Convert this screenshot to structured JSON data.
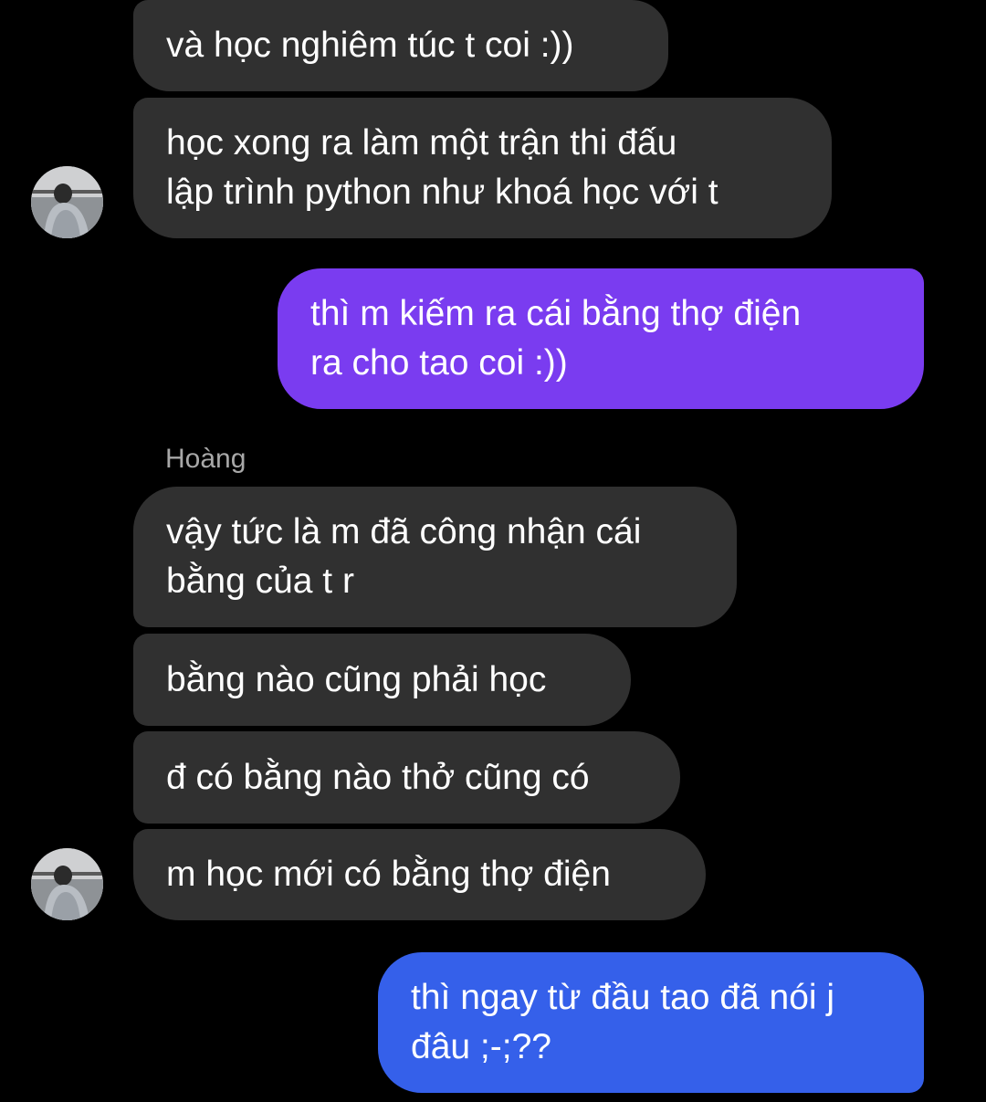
{
  "contact": {
    "name": "Hoàng"
  },
  "colors": {
    "background": "#000000",
    "incoming_bubble": "#303030",
    "outgoing_bubble_top": "#7a3cf0",
    "outgoing_bubble_bottom": "#3560ea",
    "sender_name": "#a8a8a8",
    "text": "#ffffff"
  },
  "messages": [
    {
      "direction": "incoming",
      "lines": [
        "và học nghiêm túc t coi :))"
      ]
    },
    {
      "direction": "incoming",
      "lines": [
        "học xong ra làm một trận thi đấu",
        "lập trình python như khoá học với t"
      ]
    },
    {
      "direction": "outgoing",
      "lines": [
        "thì m kiếm ra cái bằng thợ điện",
        "ra cho tao coi :))"
      ]
    },
    {
      "direction": "incoming",
      "lines": [
        "vậy tức là m đã công nhận cái",
        "bằng của t r"
      ]
    },
    {
      "direction": "incoming",
      "lines": [
        "bằng nào cũng phải học"
      ]
    },
    {
      "direction": "incoming",
      "lines": [
        "đ có bằng nào thở cũng có"
      ]
    },
    {
      "direction": "incoming",
      "lines": [
        "m học mới có bằng thợ điện"
      ]
    },
    {
      "direction": "outgoing",
      "lines": [
        "thì ngay từ đầu tao đã nói j",
        "đâu ;-;??"
      ]
    }
  ],
  "avatars": [
    {
      "icon": "contact-avatar-photo"
    },
    {
      "icon": "contact-avatar-photo"
    }
  ]
}
